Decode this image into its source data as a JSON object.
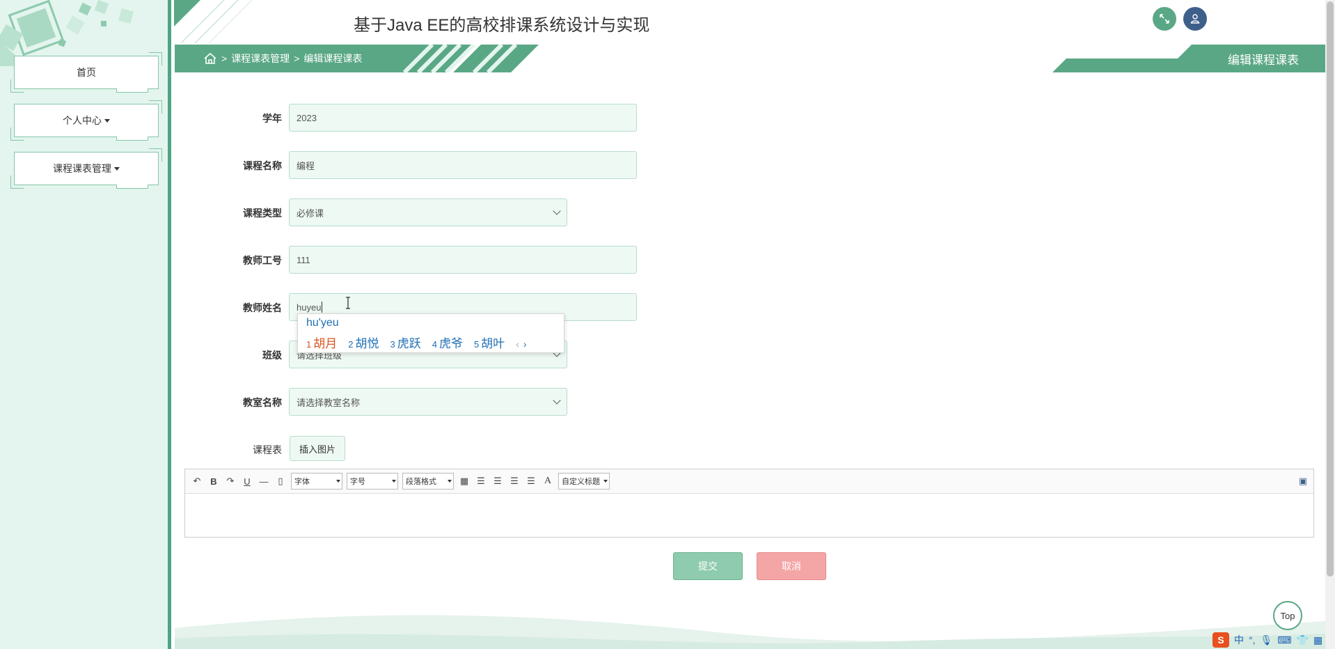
{
  "header": {
    "title": "基于Java EE的高校排课系统设计与实现"
  },
  "sidebar": {
    "items": [
      {
        "label": "首页",
        "has_dropdown": false
      },
      {
        "label": "个人中心",
        "has_dropdown": true
      },
      {
        "label": "课程课表管理",
        "has_dropdown": true
      }
    ]
  },
  "breadcrumb": {
    "sep1": ">",
    "level1": "课程课表管理",
    "sep2": ">",
    "level2": "编辑课程课表"
  },
  "page_title": "编辑课程课表",
  "form": {
    "year": {
      "label": "学年",
      "value": "2023"
    },
    "course_name": {
      "label": "课程名称",
      "value": "编程"
    },
    "course_type": {
      "label": "课程类型",
      "value": "必修课"
    },
    "teacher_id": {
      "label": "教师工号",
      "value": "111"
    },
    "teacher_name": {
      "label": "教师姓名",
      "value": "huyeu"
    },
    "class": {
      "label": "班级",
      "value": "请选择班级"
    },
    "classroom": {
      "label": "教室名称",
      "value": "请选择教室名称"
    },
    "schedule": {
      "label": "课程表",
      "insert_label": "插入图片"
    }
  },
  "editor": {
    "toolbar": {
      "bold": "B",
      "underline": "U",
      "font_label": "字体",
      "size_label": "字号",
      "paragraph_label": "段落格式",
      "font_color": "A",
      "custom_title_label": "自定义标题"
    }
  },
  "buttons": {
    "submit": "提交",
    "cancel": "取消"
  },
  "ime": {
    "composition": "hu'yeu",
    "candidates": [
      {
        "num": "1",
        "text": "胡月"
      },
      {
        "num": "2",
        "text": "胡悦"
      },
      {
        "num": "3",
        "text": "虎跃"
      },
      {
        "num": "4",
        "text": "虎爷"
      },
      {
        "num": "5",
        "text": "胡叶"
      }
    ]
  },
  "top_button": "Top",
  "tray": {
    "ime_mode": "中"
  },
  "colors": {
    "primary": "#5aa785",
    "sidebar_bg": "#e3f5ee",
    "field_bg": "#eef9f3",
    "submit": "#8fcbae",
    "cancel": "#f4a5a5"
  }
}
